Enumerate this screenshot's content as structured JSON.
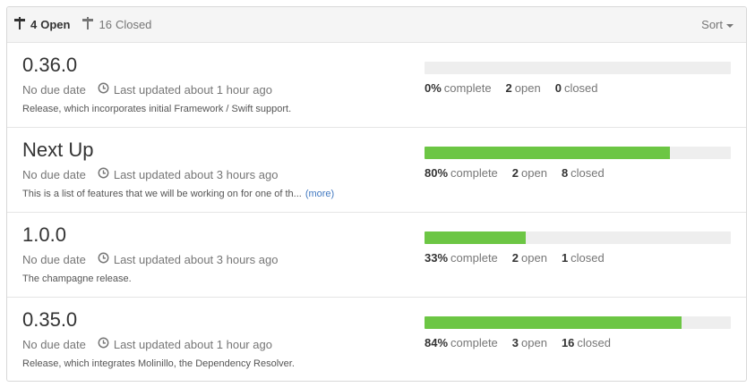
{
  "header": {
    "open_count": "4",
    "open_label": "Open",
    "closed_count": "16",
    "closed_label": "Closed",
    "sort_label": "Sort"
  },
  "icons": {
    "milestone": "milestone-icon",
    "clock": "clock-icon",
    "caret": "chevron-down-icon"
  },
  "colors": {
    "progress_fill": "#6cc644",
    "progress_track": "#eeeeee",
    "link": "#4078c0"
  },
  "milestones": [
    {
      "title": "0.36.0",
      "due": "No due date",
      "updated": "Last updated about 1 hour ago",
      "description": "Release, which incorporates initial Framework / Swift support.",
      "more": "",
      "percent": 0,
      "percent_text": "0%",
      "complete_label": "complete",
      "open_count": "2",
      "open_label": "open",
      "closed_count": "0",
      "closed_label": "closed"
    },
    {
      "title": "Next Up",
      "due": "No due date",
      "updated": "Last updated about 3 hours ago",
      "description": "This is a list of features that we will be working on for one of th...",
      "more": "(more)",
      "percent": 80,
      "percent_text": "80%",
      "complete_label": "complete",
      "open_count": "2",
      "open_label": "open",
      "closed_count": "8",
      "closed_label": "closed"
    },
    {
      "title": "1.0.0",
      "due": "No due date",
      "updated": "Last updated about 3 hours ago",
      "description": "The champagne release.",
      "more": "",
      "percent": 33,
      "percent_text": "33%",
      "complete_label": "complete",
      "open_count": "2",
      "open_label": "open",
      "closed_count": "1",
      "closed_label": "closed"
    },
    {
      "title": "0.35.0",
      "due": "No due date",
      "updated": "Last updated about 1 hour ago",
      "description": "Release, which integrates Molinillo, the Dependency Resolver.",
      "more": "",
      "percent": 84,
      "percent_text": "84%",
      "complete_label": "complete",
      "open_count": "3",
      "open_label": "open",
      "closed_count": "16",
      "closed_label": "closed"
    }
  ]
}
